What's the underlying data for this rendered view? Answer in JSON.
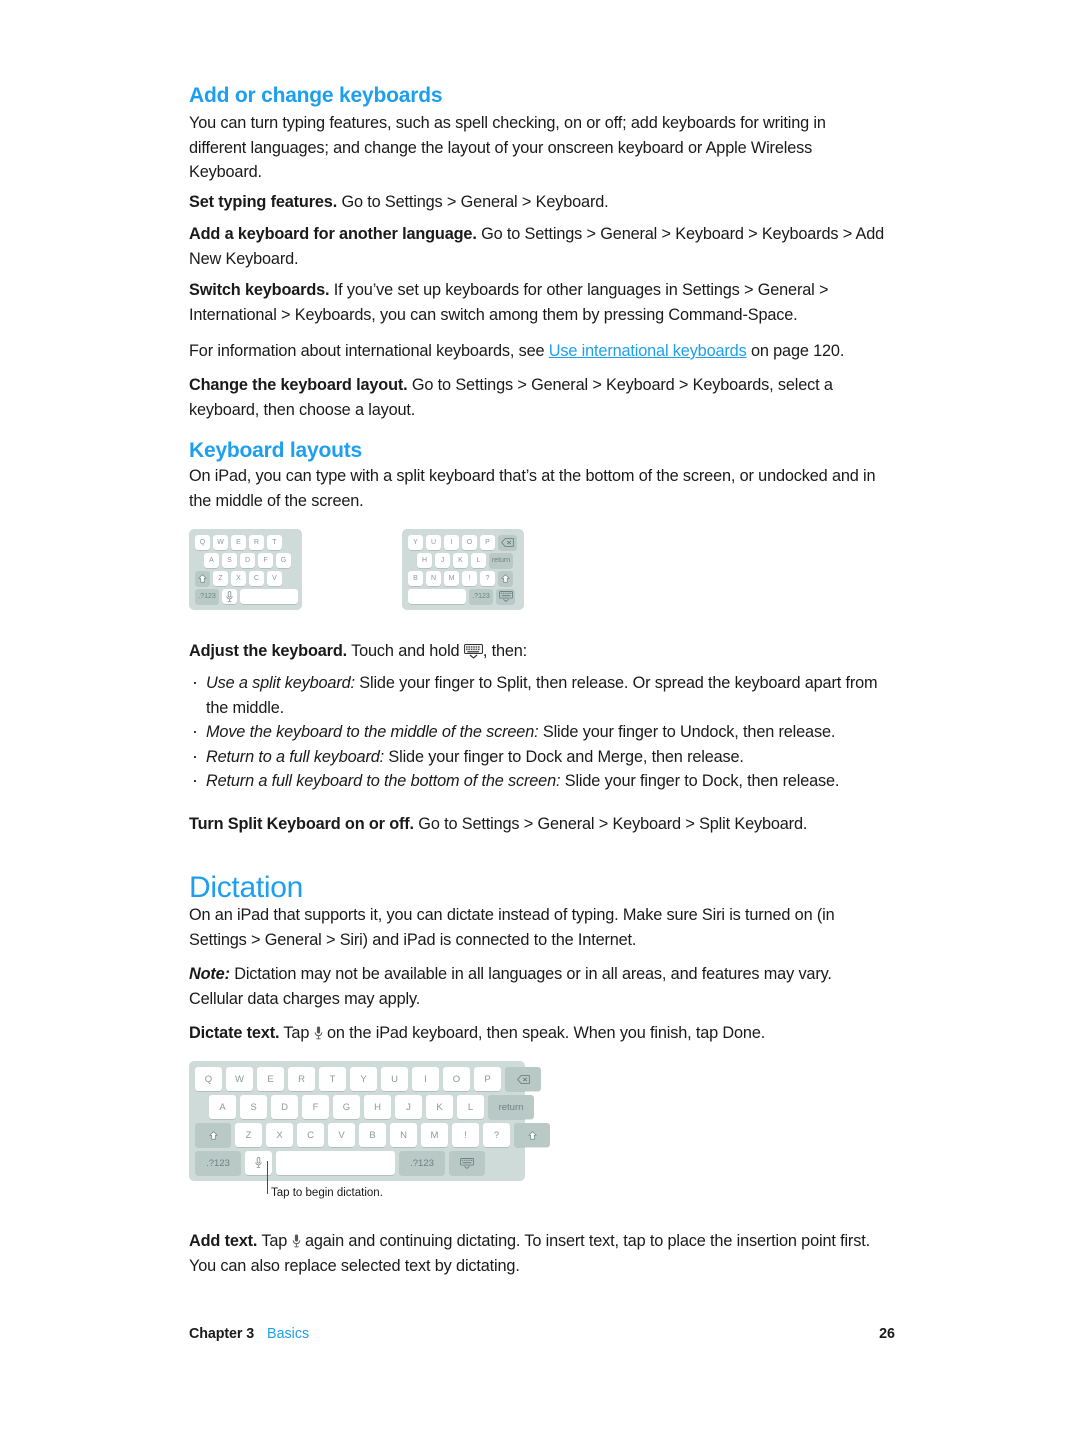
{
  "sections": {
    "keyboards": {
      "heading": "Add or change keyboards",
      "intro": "You can turn typing features, such as spell checking, on or off; add keyboards for writing in different languages; and change the layout of your onscreen keyboard or Apple Wireless Keyboard.",
      "tips": [
        {
          "lead": "Set typing features.",
          "rest": " Go to Settings > General > Keyboard."
        },
        {
          "lead": "Add a keyboard for another language.",
          "rest": " Go to Settings > General > Keyboard > Keyboards > Add New Keyboard."
        },
        {
          "lead": "Switch keyboards.",
          "rest": " If you’ve set up keyboards for other languages in Settings > General > International > Keyboards, you can switch among them by pressing Command-Space."
        }
      ],
      "crossref": {
        "before": "For information about international keyboards, see ",
        "link": "Use international keyboards",
        "after": " on page  120."
      },
      "layout_tip": {
        "lead": "Change the keyboard layout.",
        "rest": " Go to Settings > General > Keyboard > Keyboards, select a keyboard, then choose a layout."
      }
    },
    "layouts": {
      "heading": "Keyboard layouts",
      "intro": "On iPad, you can type with a split keyboard that’s at the bottom of the screen, or undocked and in the middle of the screen.",
      "adjust": {
        "lead": "Adjust the keyboard.",
        "mid": " Touch and hold ",
        "rest": ", then:"
      },
      "bullets": [
        {
          "ital": "Use a split keyboard:",
          "rest": "  Slide your finger to Split, then release. Or spread the keyboard apart from the middle."
        },
        {
          "ital": "Move the keyboard to the middle of the screen:",
          "rest": "  Slide your finger to Undock, then release."
        },
        {
          "ital": "Return to a full keyboard:",
          "rest": "  Slide your finger to Dock and Merge, then release."
        },
        {
          "ital": "Return a full keyboard to the bottom of the screen:",
          "rest": "  Slide your finger to Dock, then release."
        }
      ],
      "split_tip": {
        "lead": "Turn Split Keyboard on or off.",
        "rest": " Go to Settings > General > Keyboard > Split Keyboard."
      }
    },
    "dictation": {
      "heading": "Dictation",
      "intro": "On an iPad that supports it, you can dictate instead of typing. Make sure Siri is turned on (in Settings > General > Siri) and iPad is connected to the Internet.",
      "note_lead": "Note:",
      "note_rest": "  Dictation may not be available in all languages or in all areas, and features may vary. Cellular data charges may apply.",
      "dictate_tip": {
        "lead": "Dictate text.",
        "mid": " Tap ",
        "rest": " on the iPad keyboard, then speak. When you finish, tap Done."
      },
      "caption": "Tap to begin dictation.",
      "add_tip": {
        "lead": "Add text.",
        "mid": " Tap ",
        "rest": " again and continuing dictating. To insert text, tap to place the insertion point first. You can also replace selected text by dictating."
      }
    }
  },
  "keyboards": {
    "split_left": {
      "rows": [
        [
          {
            "label": "Q"
          },
          {
            "label": "W"
          },
          {
            "label": "E"
          },
          {
            "label": "R"
          },
          {
            "label": "T"
          }
        ],
        [
          {
            "label": "A"
          },
          {
            "label": "S"
          },
          {
            "label": "D"
          },
          {
            "label": "F"
          },
          {
            "label": "G"
          }
        ],
        [
          {
            "label": "shift-icon",
            "dark": true
          },
          {
            "label": "Z"
          },
          {
            "label": "X"
          },
          {
            "label": "C"
          },
          {
            "label": "V"
          }
        ],
        [
          {
            "label": ".?123",
            "dark": true
          },
          {
            "label": "mic-icon"
          },
          {
            "label": "space"
          }
        ]
      ]
    },
    "split_right": {
      "rows": [
        [
          {
            "label": "Y"
          },
          {
            "label": "U"
          },
          {
            "label": "I"
          },
          {
            "label": "O"
          },
          {
            "label": "P"
          },
          {
            "label": "backspace-icon",
            "dark": true
          }
        ],
        [
          {
            "label": "H"
          },
          {
            "label": "J"
          },
          {
            "label": "K"
          },
          {
            "label": "L"
          },
          {
            "label": "return",
            "dark": true
          }
        ],
        [
          {
            "label": "B"
          },
          {
            "label": "N"
          },
          {
            "label": "M"
          },
          {
            "label": "!"
          },
          {
            "label": "?"
          },
          {
            "label": "shift-icon",
            "dark": true
          }
        ],
        [
          {
            "label": "space"
          },
          {
            "label": ".?123",
            "dark": true
          },
          {
            "label": "hide-keyboard-icon",
            "dark": true
          }
        ]
      ]
    },
    "full": {
      "rows": [
        [
          {
            "label": "Q"
          },
          {
            "label": "W"
          },
          {
            "label": "E"
          },
          {
            "label": "R"
          },
          {
            "label": "T"
          },
          {
            "label": "Y"
          },
          {
            "label": "U"
          },
          {
            "label": "I"
          },
          {
            "label": "O"
          },
          {
            "label": "P"
          },
          {
            "label": "backspace-icon",
            "dark": true
          }
        ],
        [
          {
            "label": "A"
          },
          {
            "label": "S"
          },
          {
            "label": "D"
          },
          {
            "label": "F"
          },
          {
            "label": "G"
          },
          {
            "label": "H"
          },
          {
            "label": "J"
          },
          {
            "label": "K"
          },
          {
            "label": "L"
          },
          {
            "label": "return",
            "dark": true
          }
        ],
        [
          {
            "label": "shift-icon",
            "dark": true
          },
          {
            "label": "Z"
          },
          {
            "label": "X"
          },
          {
            "label": "C"
          },
          {
            "label": "V"
          },
          {
            "label": "B"
          },
          {
            "label": "N"
          },
          {
            "label": "M"
          },
          {
            "label": "!"
          },
          {
            "label": "?"
          },
          {
            "label": "shift-icon",
            "dark": true
          }
        ],
        [
          {
            "label": ".?123",
            "dark": true
          },
          {
            "label": "mic-icon"
          },
          {
            "label": "space"
          },
          {
            "label": ".?123",
            "dark": true
          },
          {
            "label": "hide-keyboard-icon",
            "dark": true
          }
        ]
      ]
    }
  },
  "footer": {
    "chapter": "Chapter  3",
    "section": "Basics",
    "page": "26"
  },
  "colors": {
    "accent": "#1d9ff0",
    "keyboard_bg": "#cfdbd8",
    "key_bg": "#ffffff",
    "key_dark_bg": "#b9c9c6",
    "key_text": "#8a9a99"
  }
}
